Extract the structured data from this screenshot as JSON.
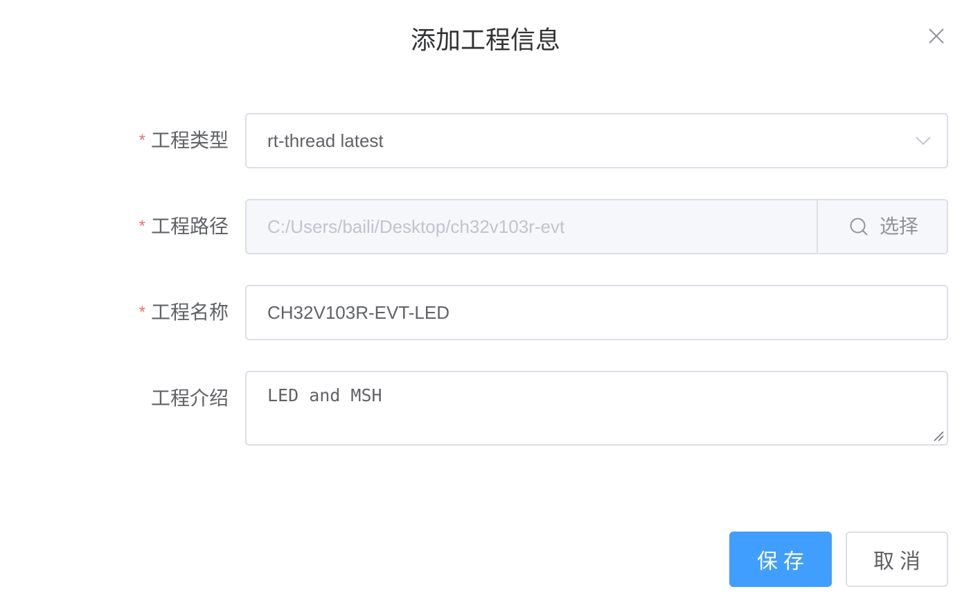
{
  "dialog": {
    "title": "添加工程信息"
  },
  "form": {
    "required_mark": "*",
    "project_type": {
      "label": "工程类型",
      "value": "rt-thread latest"
    },
    "project_path": {
      "label": "工程路径",
      "placeholder": "C:/Users/baili/Desktop/ch32v103r-evt",
      "append_label": "选择"
    },
    "project_name": {
      "label": "工程名称",
      "value": "CH32V103R-EVT-LED"
    },
    "project_intro": {
      "label": "工程介绍",
      "value": "LED and MSH"
    }
  },
  "footer": {
    "save_label": "保存",
    "cancel_label": "取消"
  },
  "colors": {
    "primary": "#409eff",
    "required": "#f56c6c",
    "border": "#dcdfe6",
    "disabled_bg": "#f5f7fa"
  },
  "icons": {
    "close": "close-icon",
    "dropdown": "chevron-down-icon",
    "search": "search-icon",
    "resize": "resize-handle-icon"
  }
}
